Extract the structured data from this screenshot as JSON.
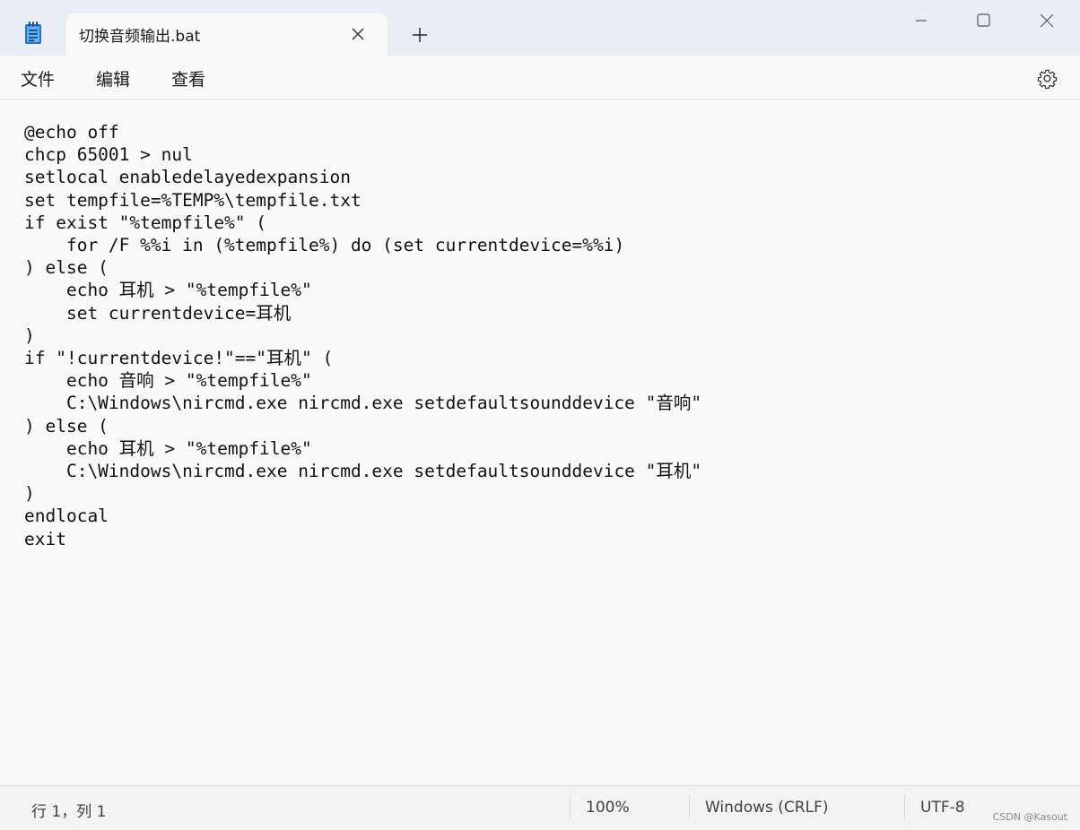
{
  "window": {
    "tab_title": "切换音频输出.bat",
    "new_tab_label": "+"
  },
  "menu": {
    "items": [
      {
        "label": "文件"
      },
      {
        "label": "编辑"
      },
      {
        "label": "查看"
      }
    ]
  },
  "editor": {
    "content": "@echo off\nchcp 65001 > nul\nsetlocal enabledelayedexpansion\nset tempfile=%TEMP%\\tempfile.txt\nif exist \"%tempfile%\" (\n    for /F %%i in (%tempfile%) do (set currentdevice=%%i)\n) else (\n    echo 耳机 > \"%tempfile%\"\n    set currentdevice=耳机\n)\nif \"!currentdevice!\"==\"耳机\" (\n    echo 音响 > \"%tempfile%\"\n    C:\\Windows\\nircmd.exe nircmd.exe setdefaultsounddevice \"音响\"\n) else (\n    echo 耳机 > \"%tempfile%\"\n    C:\\Windows\\nircmd.exe nircmd.exe setdefaultsounddevice \"耳机\"\n)\nendlocal\nexit"
  },
  "status": {
    "position": "行 1，列 1",
    "zoom": "100%",
    "line_ending": "Windows (CRLF)",
    "encoding": "UTF-8"
  },
  "watermark": "CSDN @Kasout",
  "icons": {
    "app": "notepad-icon",
    "close_tab": "close-icon",
    "new_tab": "plus-icon",
    "minimize": "minimize-icon",
    "maximize": "maximize-icon",
    "close_window": "close-icon",
    "settings": "gear-icon"
  },
  "colors": {
    "titlebar_bg": "#e9eef6",
    "editor_bg": "#f9f9f9",
    "text": "#111111",
    "icon_blue": "#1f7bd6"
  }
}
